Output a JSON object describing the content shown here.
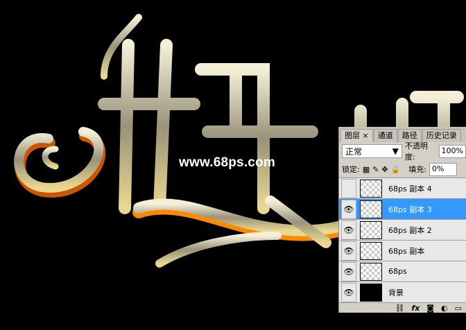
{
  "canvas": {
    "watermark": "www.68ps.com"
  },
  "panel": {
    "tabs": [
      {
        "label": "图层 ×"
      },
      {
        "label": "通道"
      },
      {
        "label": "路径"
      },
      {
        "label": "历史记录"
      }
    ],
    "blend_mode": "正常",
    "opacity_label": "不透明度:",
    "opacity_value": "100%",
    "lock_label": "锁定:",
    "fill_label": "填充:",
    "fill_value": "0%",
    "layers": [
      {
        "name": "68ps 副本 4",
        "visible": false,
        "selected": false
      },
      {
        "name": "68ps 副本 3",
        "visible": true,
        "selected": true
      },
      {
        "name": "68ps 副本 2",
        "visible": true,
        "selected": false
      },
      {
        "name": "68ps 副本",
        "visible": true,
        "selected": false
      },
      {
        "name": "68ps",
        "visible": true,
        "selected": false
      },
      {
        "name": "背景",
        "visible": true,
        "selected": false
      }
    ],
    "eye_glyph": "👁",
    "bottom_icons": {
      "link": "⛓",
      "fx": "fx",
      "mask": "◙",
      "adjust": "◐",
      "folder": "▭"
    },
    "selected_color": "#3399ff"
  }
}
